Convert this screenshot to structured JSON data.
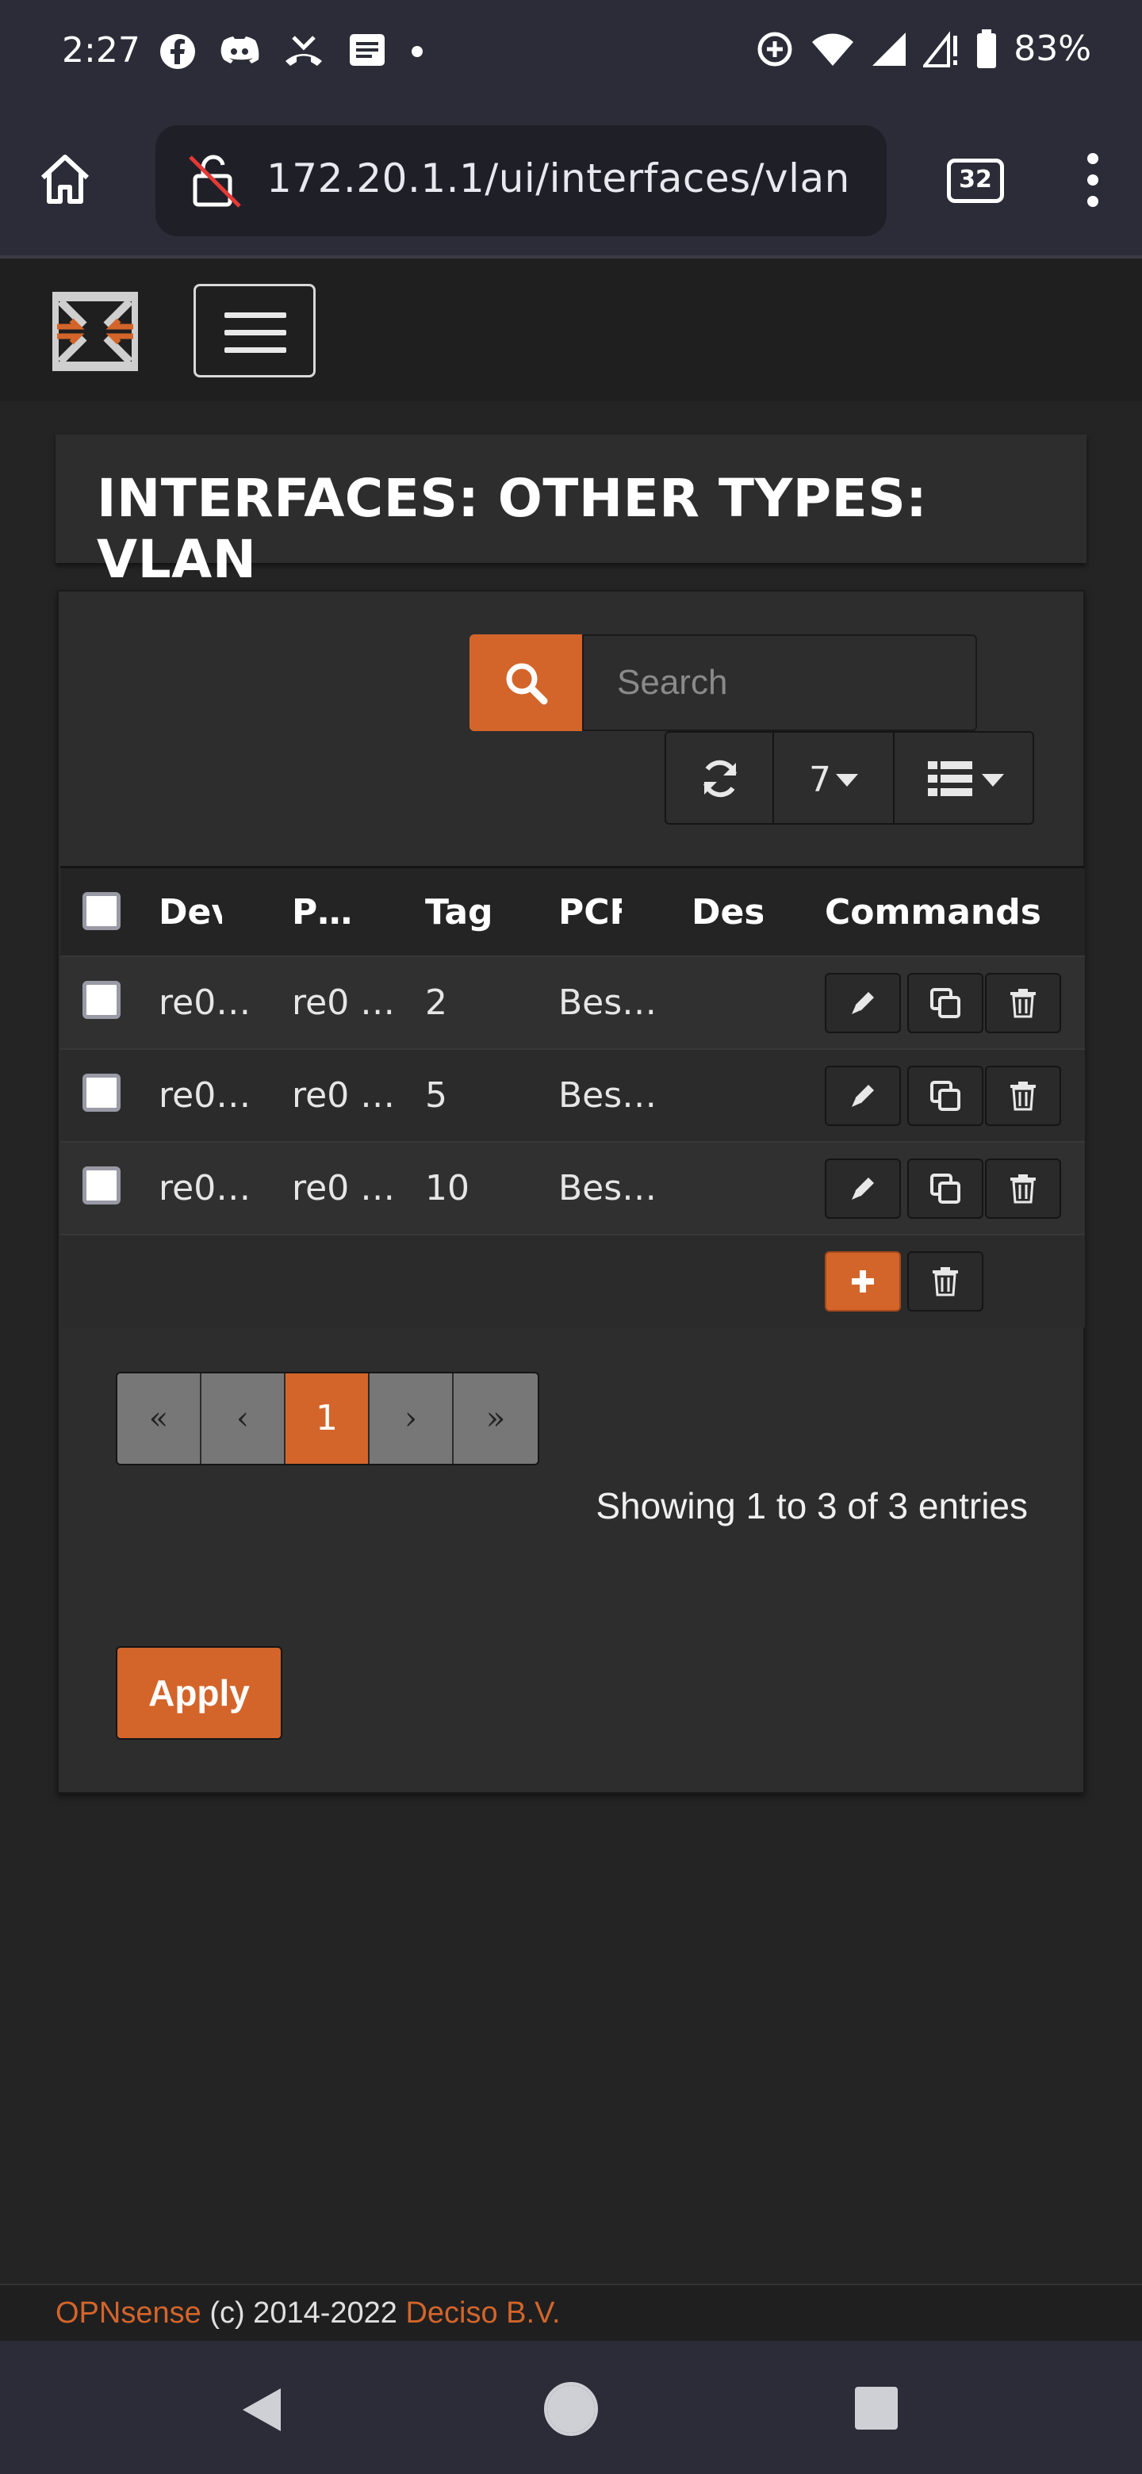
{
  "status_bar": {
    "time": "2:27",
    "battery": "83%",
    "left_icons": [
      "facebook-icon",
      "discord-icon",
      "missed-call-icon",
      "message-icon",
      "dot-icon"
    ],
    "right_icons": [
      "data-saver-icon",
      "wifi-icon",
      "signal-icon",
      "signal-alert-icon",
      "battery-icon"
    ]
  },
  "browser": {
    "url": "172.20.1.1/ui/interfaces/vlan",
    "tab_count": "32"
  },
  "page": {
    "title": "INTERFACES: OTHER TYPES: VLAN"
  },
  "grid": {
    "search_placeholder": "Search",
    "page_size": "7",
    "columns": [
      "Dev",
      "P…",
      "Tag",
      "PCF",
      "Des",
      "Commands"
    ],
    "rows": [
      {
        "device": "re0…",
        "parent": "re0 …",
        "tag": "2",
        "pcp": "Bes…",
        "description": ""
      },
      {
        "device": "re0…",
        "parent": "re0 …",
        "tag": "5",
        "pcp": "Bes…",
        "description": ""
      },
      {
        "device": "re0…",
        "parent": "re0 …",
        "tag": "10",
        "pcp": "Bes…",
        "description": ""
      }
    ],
    "pagination": {
      "first": "«",
      "prev": "‹",
      "current": "1",
      "next": "›",
      "last": "»"
    },
    "info": "Showing 1 to 3 of 3 entries"
  },
  "actions": {
    "apply_label": "Apply"
  },
  "footer": {
    "product": "OPNsense",
    "copyright": "(c) 2014-2022",
    "company": "Deciso B.V."
  },
  "colors": {
    "accent": "#d3652b",
    "background": "#242424",
    "panel": "#2d2d2d"
  }
}
